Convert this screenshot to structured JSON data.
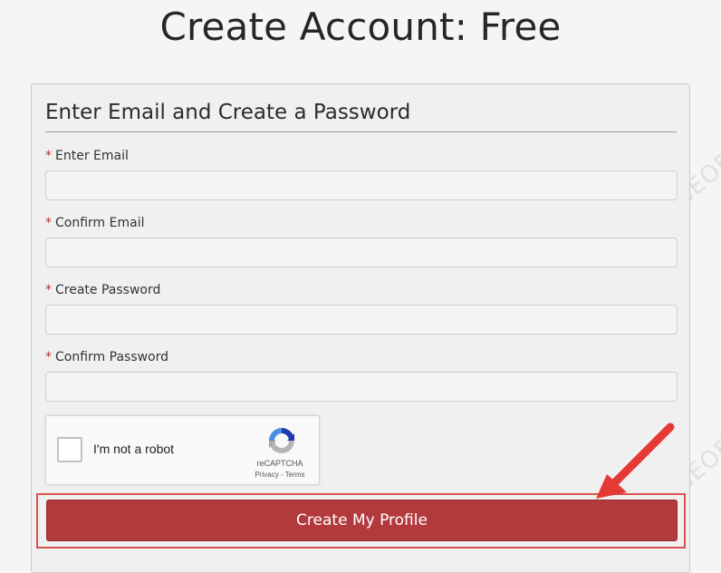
{
  "page": {
    "title": "Create Account: Free"
  },
  "form": {
    "heading": "Enter Email and Create a Password",
    "required_marker": "*",
    "fields": [
      {
        "label": "Enter Email",
        "value": ""
      },
      {
        "label": "Confirm Email",
        "value": ""
      },
      {
        "label": "Create Password",
        "value": ""
      },
      {
        "label": "Confirm Password",
        "value": ""
      }
    ],
    "captcha": {
      "label": "I'm not a robot",
      "brand": "reCAPTCHA",
      "links": "Privacy - Terms",
      "checked": false,
      "icon": "recaptcha-logo-icon"
    },
    "submit_label": "Create My Profile"
  },
  "annotations": {
    "highlight_color": "#d9534f",
    "arrow_color": "#e53935"
  },
  "watermark": {
    "brand": "SEOBUDDY",
    "site": "WWW.SEOBUDDY.COM"
  },
  "colors": {
    "button": "#b23a3d",
    "required": "#b03535"
  }
}
